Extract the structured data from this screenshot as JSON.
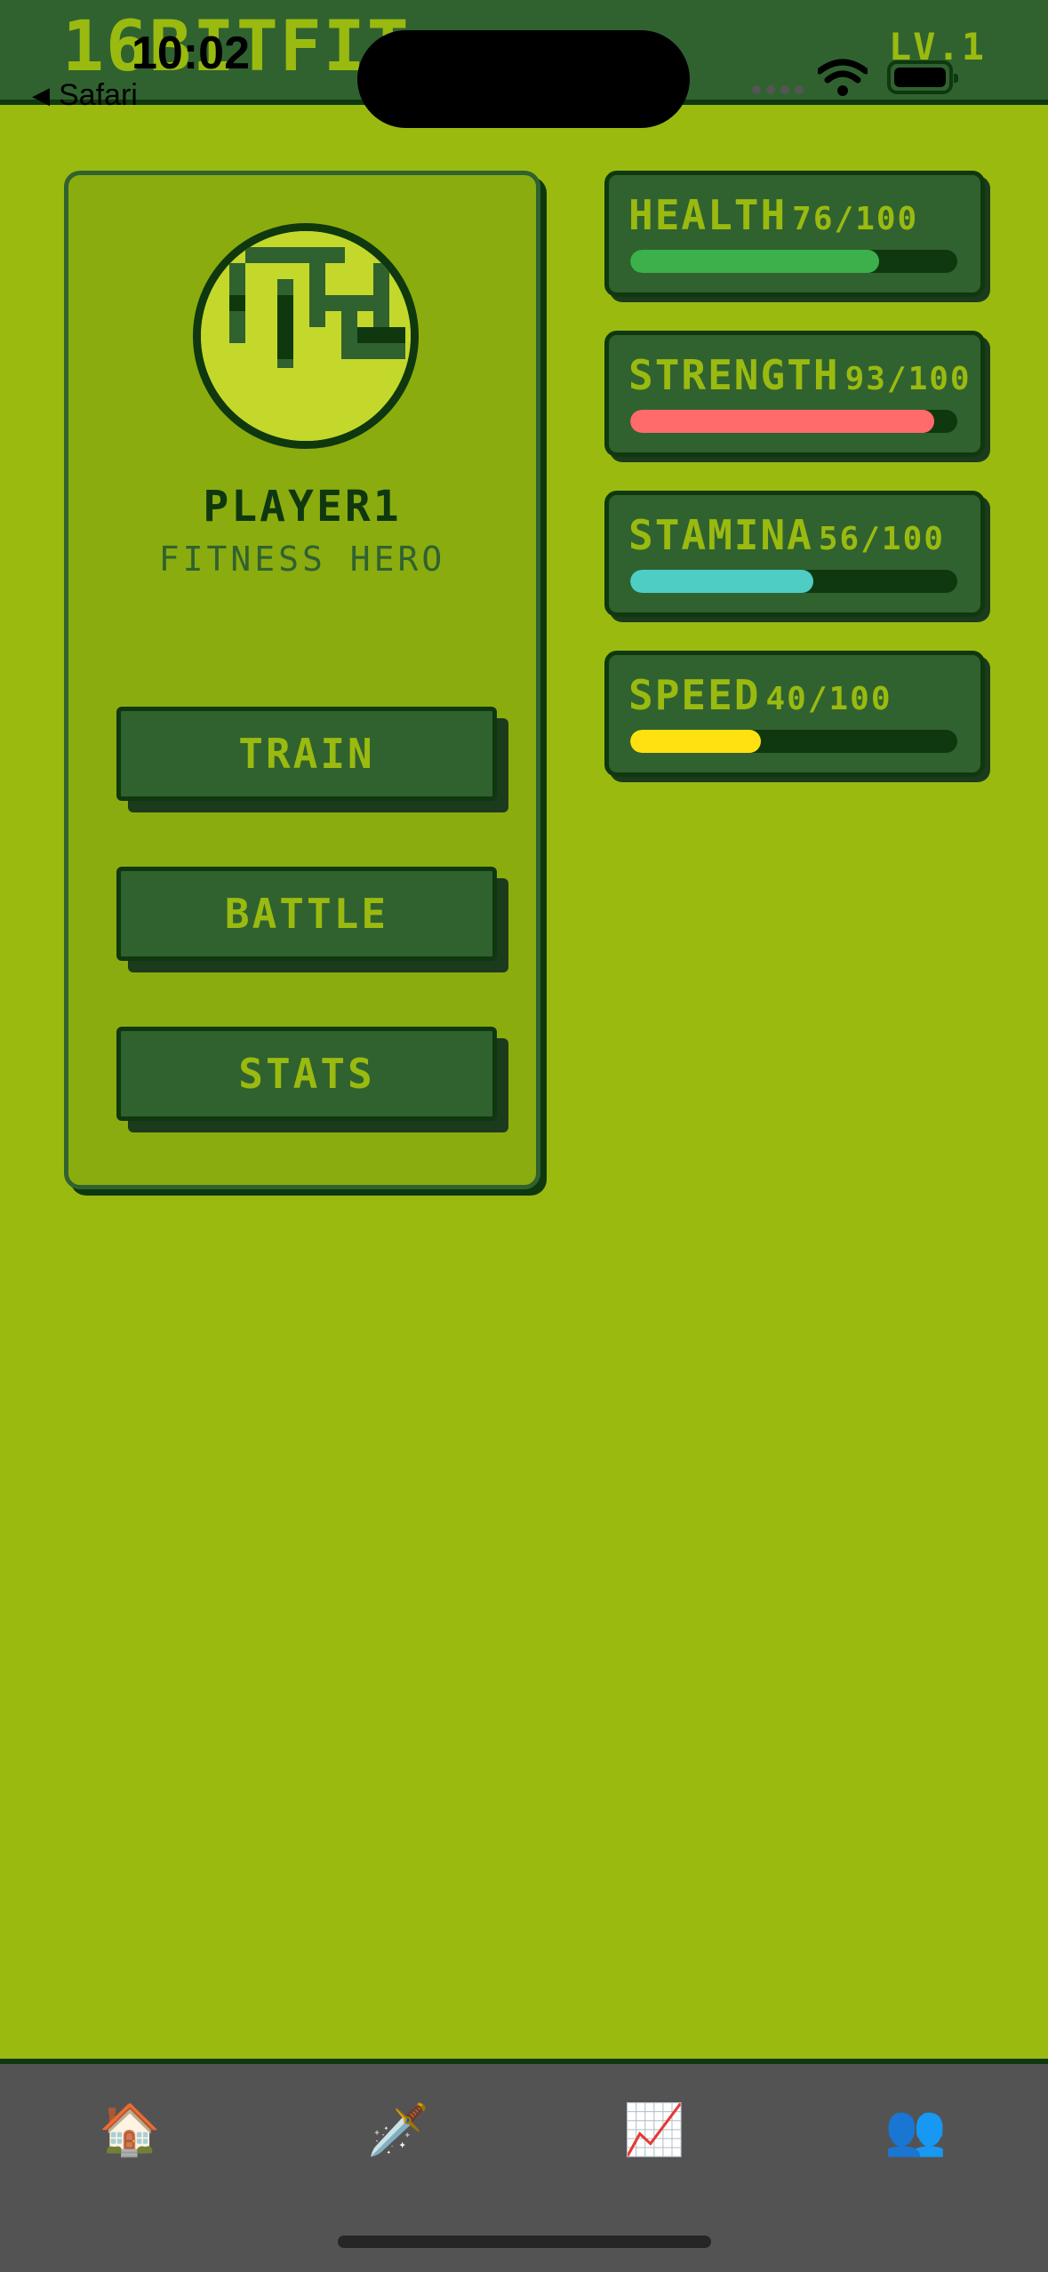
{
  "header": {
    "app_title": "16BITFIT",
    "level": "LV.1"
  },
  "status_bar": {
    "time": "10:02",
    "back_label": "Safari"
  },
  "player": {
    "name": "PLAYER1",
    "class": "FITNESS HERO",
    "avatar": "player-avatar-pixel-art"
  },
  "menu": {
    "train_label": "TRAIN",
    "battle_label": "BATTLE",
    "stats_label": "STATS"
  },
  "stats": [
    {
      "name": "HEALTH",
      "value_text": "76/100",
      "value": 76,
      "max": 100,
      "color": "#3cb04a"
    },
    {
      "name": "STRENGTH",
      "value_text": "93/100",
      "value": 93,
      "max": 100,
      "color": "#ff6b6b"
    },
    {
      "name": "STAMINA",
      "value_text": "56/100",
      "value": 56,
      "max": 100,
      "color": "#4ecdc4"
    },
    {
      "name": "SPEED",
      "value_text": "40/100",
      "value": 40,
      "max": 100,
      "color": "#ffe010"
    }
  ],
  "tabs": [
    {
      "name": "home",
      "icon": "🏠"
    },
    {
      "name": "battle",
      "icon": "🗡️"
    },
    {
      "name": "stats",
      "icon": "📈"
    },
    {
      "name": "social",
      "icon": "👥"
    }
  ],
  "colors": {
    "background": "#9aba10",
    "dark": "#0f380f",
    "medium": "#306230",
    "light": "#8bac0f"
  }
}
